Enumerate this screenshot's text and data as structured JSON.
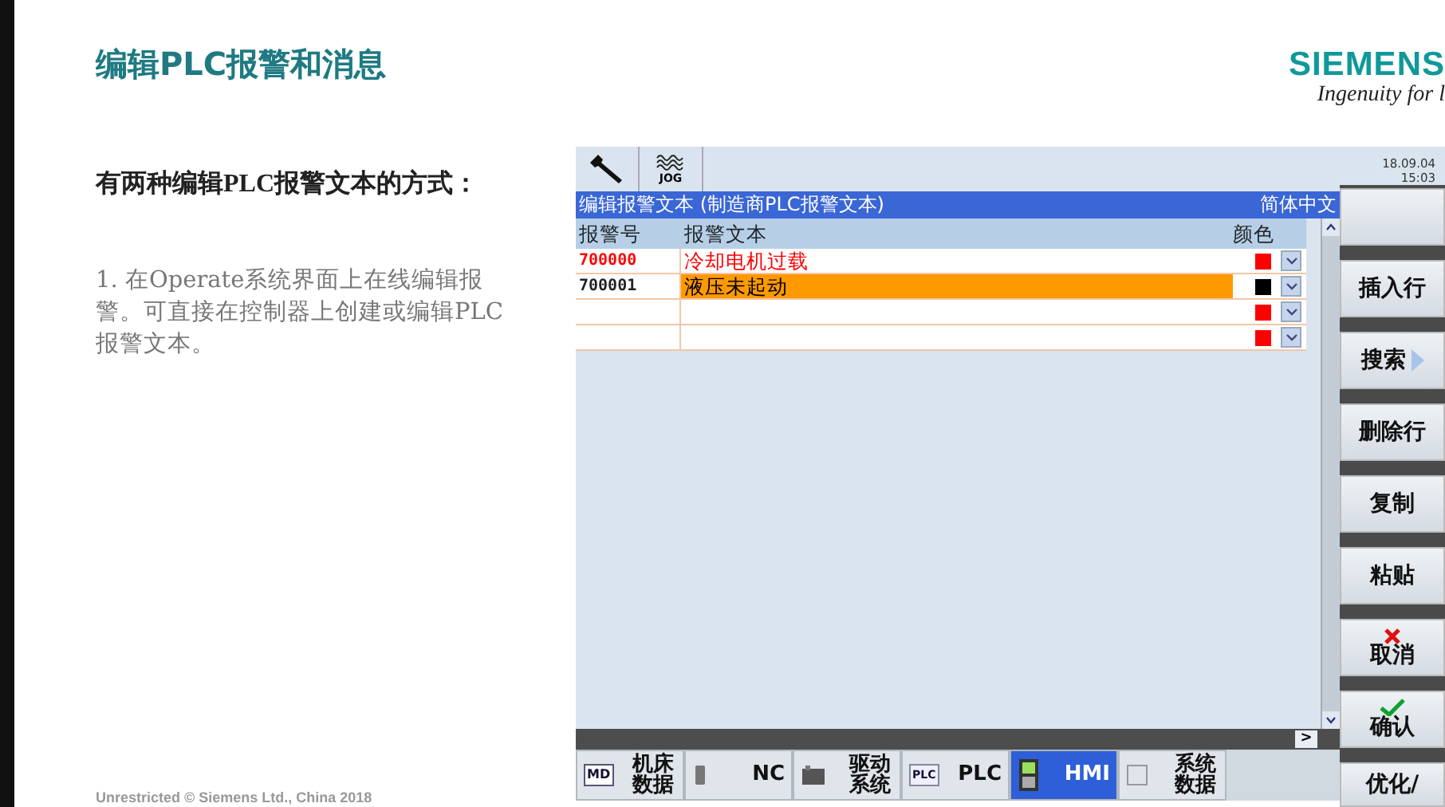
{
  "slide": {
    "title": "编辑PLC报警和消息",
    "logo": {
      "name": "SIEMENS",
      "tagline": "Ingenuity for l"
    },
    "intro": "有两种编辑PLC报警文本的方式：",
    "steps": [
      "1. 在Operate系统界面上在线编辑报警。可直接在控制器上创建或编辑PLC报警文本。"
    ],
    "footer": "Unrestricted © Siemens Ltd., China 2018"
  },
  "hmi": {
    "top_tools": [
      {
        "kind": "wrench",
        "selected": false
      },
      {
        "kind": "jog",
        "label": "JOG",
        "selected": false
      }
    ],
    "date": "18.09.04",
    "time": "15:03",
    "header": {
      "title": "编辑报警文本 (制造商PLC报警文本)",
      "language": "简体中文"
    },
    "columns": [
      "报警号",
      "报警文本",
      "颜色"
    ],
    "rows": [
      {
        "number": "700000",
        "text": "冷却电机过载",
        "color": "#ff0000",
        "selected": false
      },
      {
        "number": "700001",
        "text": "液压未起动",
        "color": "#000000",
        "selected": true
      },
      {
        "color": "#ff0000",
        "selected": false
      },
      {
        "color": "#ff0000",
        "selected": false
      }
    ],
    "scroll_right_button": ">",
    "side_keys": [
      {
        "kind": "blank"
      },
      {
        "kind": "text",
        "label": "插入行"
      },
      {
        "kind": "menu",
        "label": "搜索"
      },
      {
        "kind": "text",
        "label": "删除行"
      },
      {
        "kind": "text",
        "label": "复制"
      },
      {
        "kind": "text",
        "label": "粘贴"
      },
      {
        "kind": "cancel",
        "label": "取消"
      },
      {
        "kind": "confirm",
        "label": "确认"
      },
      {
        "kind": "text",
        "label": "优化/"
      }
    ],
    "bottom_keys": [
      {
        "kind": "md",
        "icon_text": "MD",
        "label": "机床数据",
        "selected": false
      },
      {
        "kind": "nc",
        "label": "NC",
        "selected": false
      },
      {
        "kind": "drive",
        "label": "驱动系统",
        "selected": false
      },
      {
        "kind": "plc",
        "icon_text": "PLC",
        "label": "PLC",
        "selected": false
      },
      {
        "kind": "hmi",
        "label": "HMI",
        "selected": true
      },
      {
        "kind": "sys",
        "label": "系统数据",
        "selected": false
      }
    ]
  }
}
